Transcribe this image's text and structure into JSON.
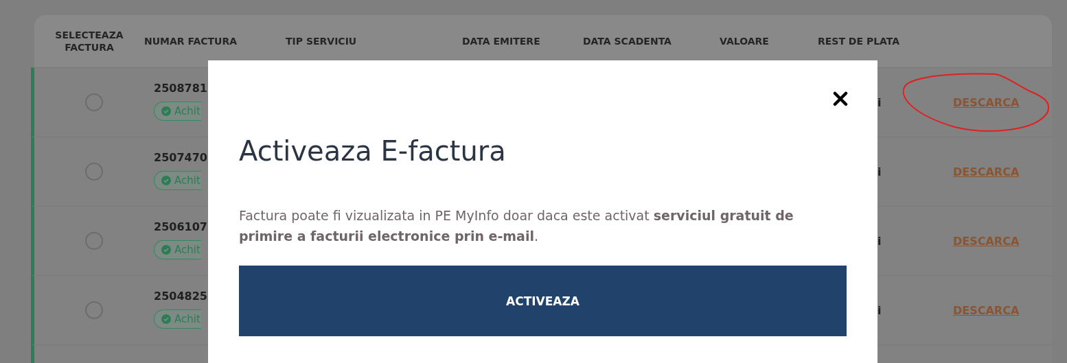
{
  "table": {
    "columns": [
      "SELECTEAZA FACTURA",
      "NUMAR FACTURA",
      "TIP SERVICIU",
      "DATA EMITERE",
      "DATA SCADENTA",
      "VALOARE",
      "REST DE PLATA"
    ],
    "rows": [
      {
        "selected": false,
        "number": "2508781",
        "status": "Achit",
        "rest": "i",
        "action": "DESCARCA",
        "highlighted": true
      },
      {
        "selected": false,
        "number": "2507470",
        "status": "Achit",
        "rest": "i",
        "action": "DESCARCA",
        "highlighted": false
      },
      {
        "selected": false,
        "number": "2506107",
        "status": "Achit",
        "rest": "i",
        "action": "DESCARCA",
        "highlighted": false
      },
      {
        "selected": false,
        "number": "2504825",
        "status": "Achit",
        "rest": "i",
        "action": "DESCARCA",
        "highlighted": false
      }
    ]
  },
  "modal": {
    "title": "Activeaza E-factura",
    "text": "Factura poate fi vizualizata in PE MyInfo doar daca este activat **serviciul gratuit de primire a facturii electronice prin e-mail**.",
    "button": "ACTIVEAZA"
  }
}
